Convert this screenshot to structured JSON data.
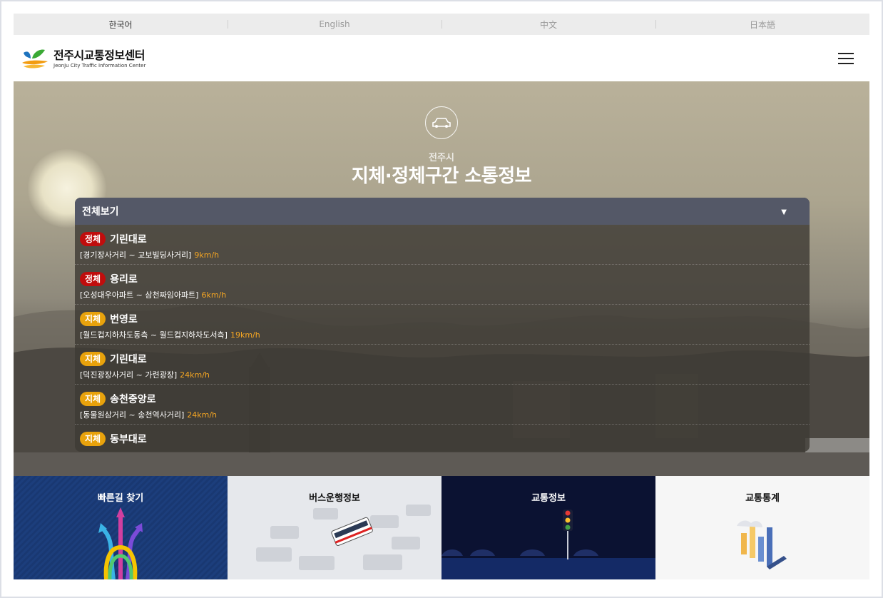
{
  "languages": [
    "한국어",
    "English",
    "中文",
    "日本語"
  ],
  "header": {
    "logo_main": "전주시교통정보센터",
    "logo_sub": "JeonJu City Traffic Information Center"
  },
  "hero": {
    "subtitle": "전주시",
    "title": "지체·정체구간 소통정보",
    "dropdown_label": "전체보기"
  },
  "traffic_items": [
    {
      "status": "정체",
      "status_color": "#c00d0d",
      "road": "기린대로",
      "section": "[경기장사거리 ~ 교보빌딩사거리]",
      "speed": "9km/h"
    },
    {
      "status": "정체",
      "status_color": "#c00d0d",
      "road": "용리로",
      "section": "[오성대우아파트 ~ 삼천짜임아파트]",
      "speed": "6km/h"
    },
    {
      "status": "지체",
      "status_color": "#e8a20c",
      "road": "번영로",
      "section": "[월드컵지하차도동측 ~ 월드컵지하차도서측]",
      "speed": "19km/h"
    },
    {
      "status": "지체",
      "status_color": "#e8a20c",
      "road": "기린대로",
      "section": "[덕진광장사거리 ~ 가련광장]",
      "speed": "24km/h"
    },
    {
      "status": "지체",
      "status_color": "#e8a20c",
      "road": "송천중앙로",
      "section": "[동물원삼거리 ~ 송천역사거리]",
      "speed": "24km/h"
    },
    {
      "status": "지체",
      "status_color": "#e8a20c",
      "road": "동부대로",
      "section": "",
      "speed": ""
    }
  ],
  "tiles": [
    {
      "label": "빠른길 찾기",
      "text_color": "#ffffff"
    },
    {
      "label": "버스운행정보",
      "text_color": "#111111"
    },
    {
      "label": "교통정보",
      "text_color": "#ffffff"
    },
    {
      "label": "교통통계",
      "text_color": "#111111"
    }
  ]
}
